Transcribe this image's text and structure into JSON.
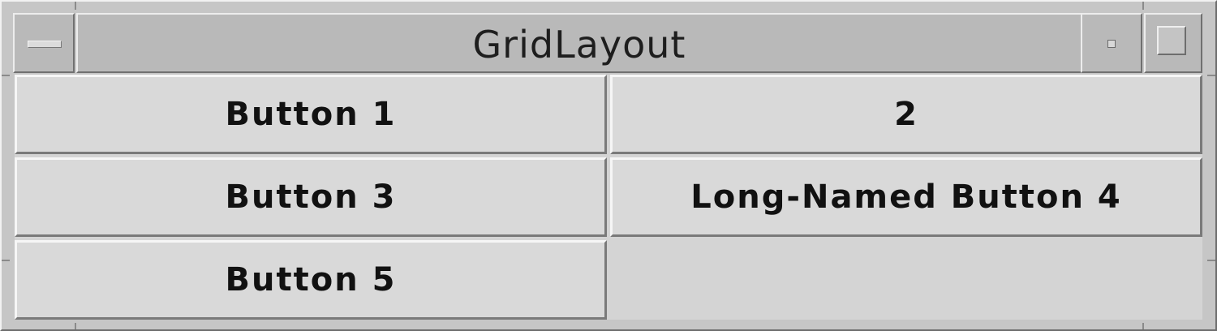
{
  "window": {
    "title": "GridLayout"
  },
  "grid": {
    "buttons": [
      {
        "label": "Button 1"
      },
      {
        "label": "2"
      },
      {
        "label": "Button 3"
      },
      {
        "label": "Long-Named Button 4"
      },
      {
        "label": "Button 5"
      }
    ]
  },
  "colors": {
    "frame": "#c6c6c6",
    "button_face": "#d9d9d9",
    "text": "#111111"
  },
  "icons": {
    "window_menu": "window-menu-icon",
    "minimize": "minimize-icon",
    "maximize": "maximize-icon"
  }
}
